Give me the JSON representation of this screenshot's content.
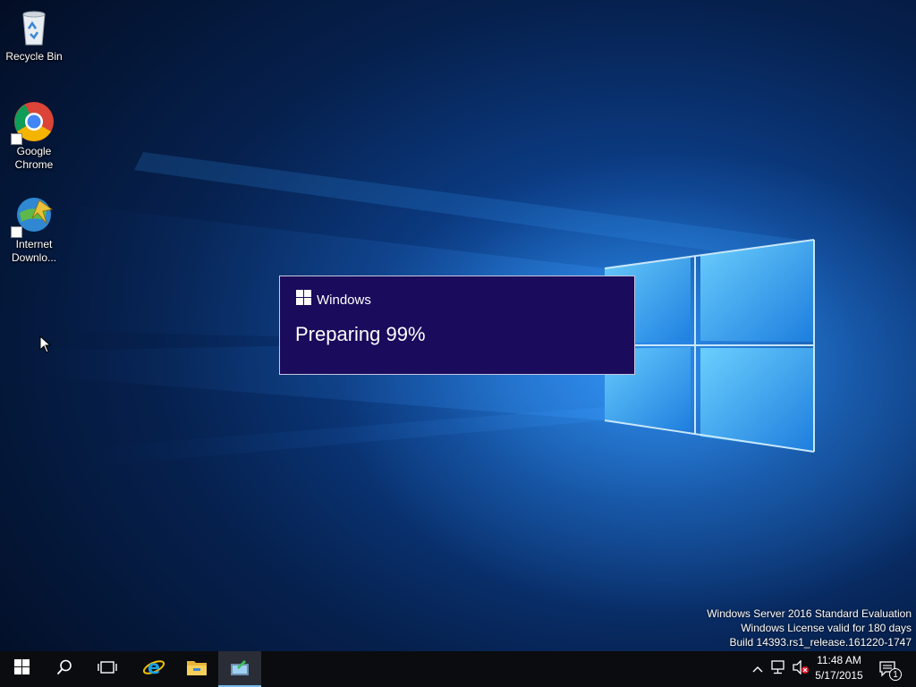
{
  "desktop": {
    "icons": [
      {
        "label": "Recycle Bin",
        "icon": "recycle-bin-icon"
      },
      {
        "label": "Google Chrome",
        "icon": "chrome-icon"
      },
      {
        "label": "Internet Downlo...",
        "icon": "internet-download-manager-icon"
      }
    ]
  },
  "dialog": {
    "title": "Windows",
    "message": "Preparing 99%",
    "progress_percent": 99,
    "background": "#1a0b5c"
  },
  "watermark": {
    "line1": "Windows Server 2016 Standard Evaluation",
    "line2": "Windows License valid for 180 days",
    "line3": "Build 14393.rs1_release.161220-1747"
  },
  "taskbar": {
    "items": [
      {
        "icon": "start-icon"
      },
      {
        "icon": "search-icon"
      },
      {
        "icon": "task-view-icon"
      },
      {
        "icon": "internet-explorer-icon"
      },
      {
        "icon": "file-explorer-icon"
      },
      {
        "icon": "active-app-icon",
        "active": true
      }
    ],
    "tray": {
      "icons": [
        "chevron-up-icon",
        "network-icon",
        "volume-muted-icon",
        "action-center-icon"
      ],
      "time": "11:48 AM",
      "date": "5/17/2015",
      "notification_count": "1"
    }
  },
  "colors": {
    "accent": "#76b9ed",
    "taskbar": "#0b0c10"
  }
}
